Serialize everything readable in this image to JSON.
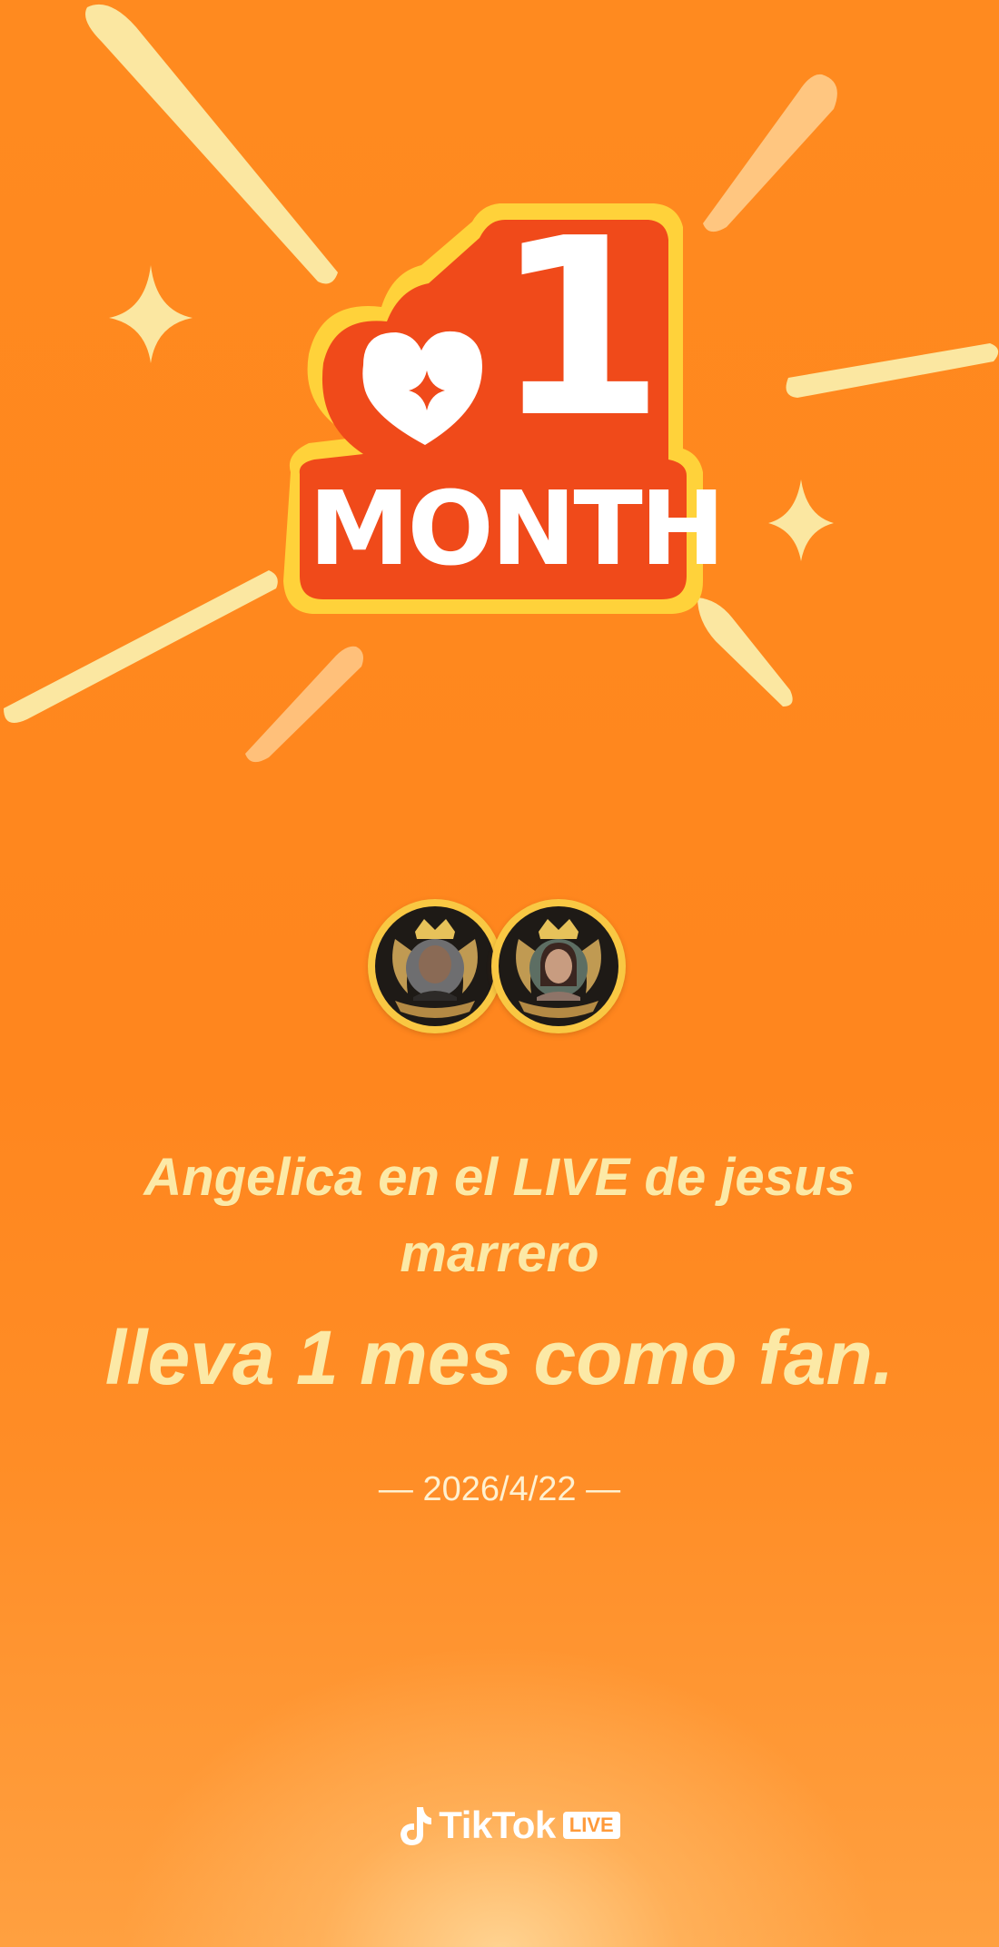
{
  "badge": {
    "number": "1",
    "word": "MONTH"
  },
  "avatars": [
    {
      "name": "jesus marrero avatar"
    },
    {
      "name": "Angelica avatar"
    }
  ],
  "message": {
    "line1": "Angelica en el LIVE de jesus marrero",
    "line2": "lleva 1 mes como fan."
  },
  "date": {
    "text": "— 2026/4/22 —"
  },
  "brand": {
    "name": "TikTok",
    "tag": "LIVE"
  },
  "colors": {
    "background": "#FF881F",
    "text": "#FCE9A6",
    "badge_red": "#F04A1A",
    "badge_border": "#FFD23A"
  }
}
